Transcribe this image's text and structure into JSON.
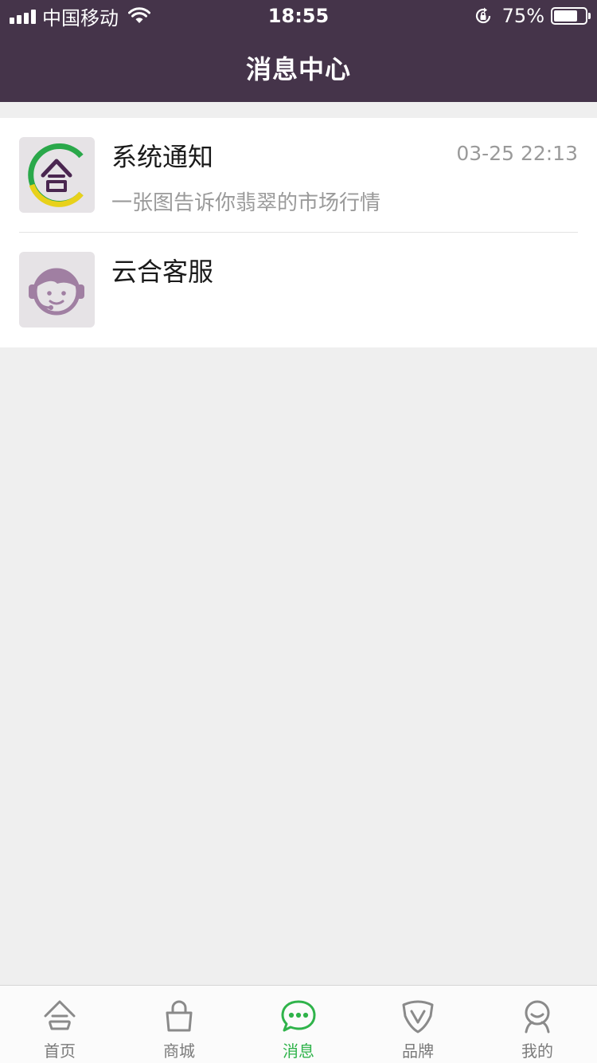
{
  "status_bar": {
    "carrier": "中国移动",
    "time": "18:55",
    "battery": "75%",
    "battery_level": 0.75
  },
  "header": {
    "title": "消息中心"
  },
  "messages": [
    {
      "title": "系统通知",
      "time": "03-25 22:13",
      "preview": "一张图告诉你翡翠的市场行情",
      "icon": "app-logo-icon"
    },
    {
      "title": "云合客服",
      "time": "",
      "preview": "",
      "icon": "customer-service-icon"
    }
  ],
  "tabs": [
    {
      "label": "首页",
      "icon": "home-icon",
      "active": false
    },
    {
      "label": "商城",
      "icon": "bag-icon",
      "active": false
    },
    {
      "label": "消息",
      "icon": "chat-icon",
      "active": true
    },
    {
      "label": "品牌",
      "icon": "brand-icon",
      "active": false
    },
    {
      "label": "我的",
      "icon": "profile-icon",
      "active": false
    }
  ],
  "colors": {
    "header_bg": "#45344a",
    "active_tab": "#2fb34a",
    "logo_green": "#2aa84a",
    "logo_yellow": "#e8d11a",
    "logo_purple": "#4a2650"
  }
}
